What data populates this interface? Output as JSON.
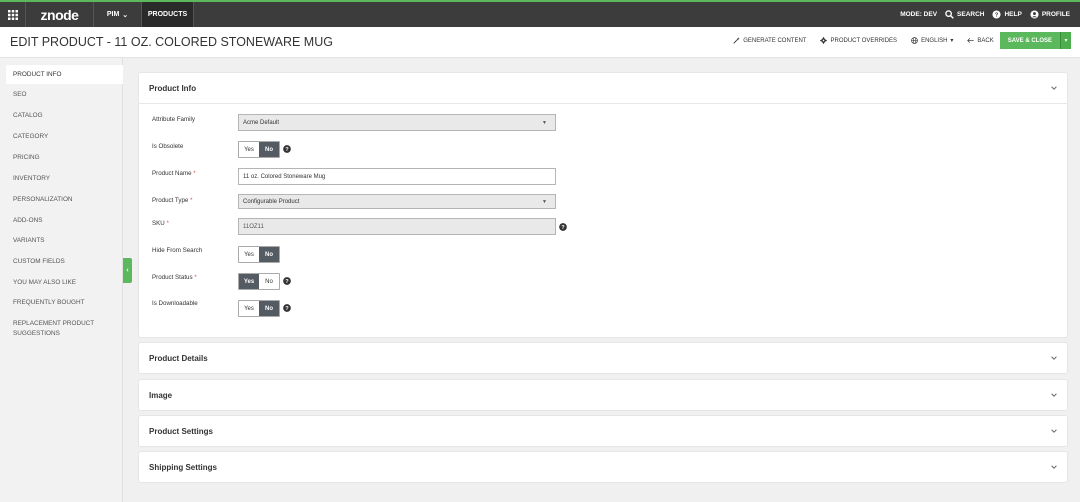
{
  "topnav": {
    "logo": "znode",
    "pim": "PIM",
    "products": "PRODUCTS",
    "mode": "MODE: DEV",
    "search": "SEARCH",
    "help": "HELP",
    "profile": "PROFILE"
  },
  "header": {
    "title": "EDIT PRODUCT - 11 OZ. COLORED STONEWARE MUG",
    "generate_content": "GENERATE CONTENT",
    "product_overrides": "PRODUCT OVERRIDES",
    "language": "ENGLISH",
    "back": "BACK",
    "save_close": "SAVE & CLOSE"
  },
  "sidebar": {
    "items": [
      "PRODUCT INFO",
      "SEO",
      "CATALOG",
      "CATEGORY",
      "PRICING",
      "INVENTORY",
      "PERSONALIZATION",
      "ADD-ONS",
      "VARIANTS",
      "CUSTOM FIELDS",
      "YOU MAY ALSO LIKE",
      "FREQUENTLY BOUGHT",
      "REPLACEMENT PRODUCT SUGGESTIONS"
    ],
    "replacement_line1": "REPLACEMENT PRODUCT",
    "replacement_line2": "SUGGESTIONS"
  },
  "product_info": {
    "title": "Product Info",
    "attribute_family_label": "Attribute Family",
    "attribute_family_value": "Acme Default",
    "is_obsolete_label": "Is Obsolete",
    "product_name_label": "Product Name",
    "product_name_value": "11 oz. Colored Stoneware Mug",
    "product_type_label": "Product Type",
    "product_type_value": "Configurable Product",
    "sku_label": "SKU",
    "sku_value": "11OZ11",
    "hide_from_search_label": "Hide From Search",
    "product_status_label": "Product Status",
    "is_downloadable_label": "Is Downloadable",
    "yes": "Yes",
    "no": "No",
    "required_mark": "*"
  },
  "panels": {
    "product_details": "Product Details",
    "image": "Image",
    "product_settings": "Product Settings",
    "shipping_settings": "Shipping Settings"
  },
  "colors": {
    "accent_green": "#5cb85c",
    "nav_dark": "#3c3c3c",
    "toggle_on": "#555b63"
  }
}
